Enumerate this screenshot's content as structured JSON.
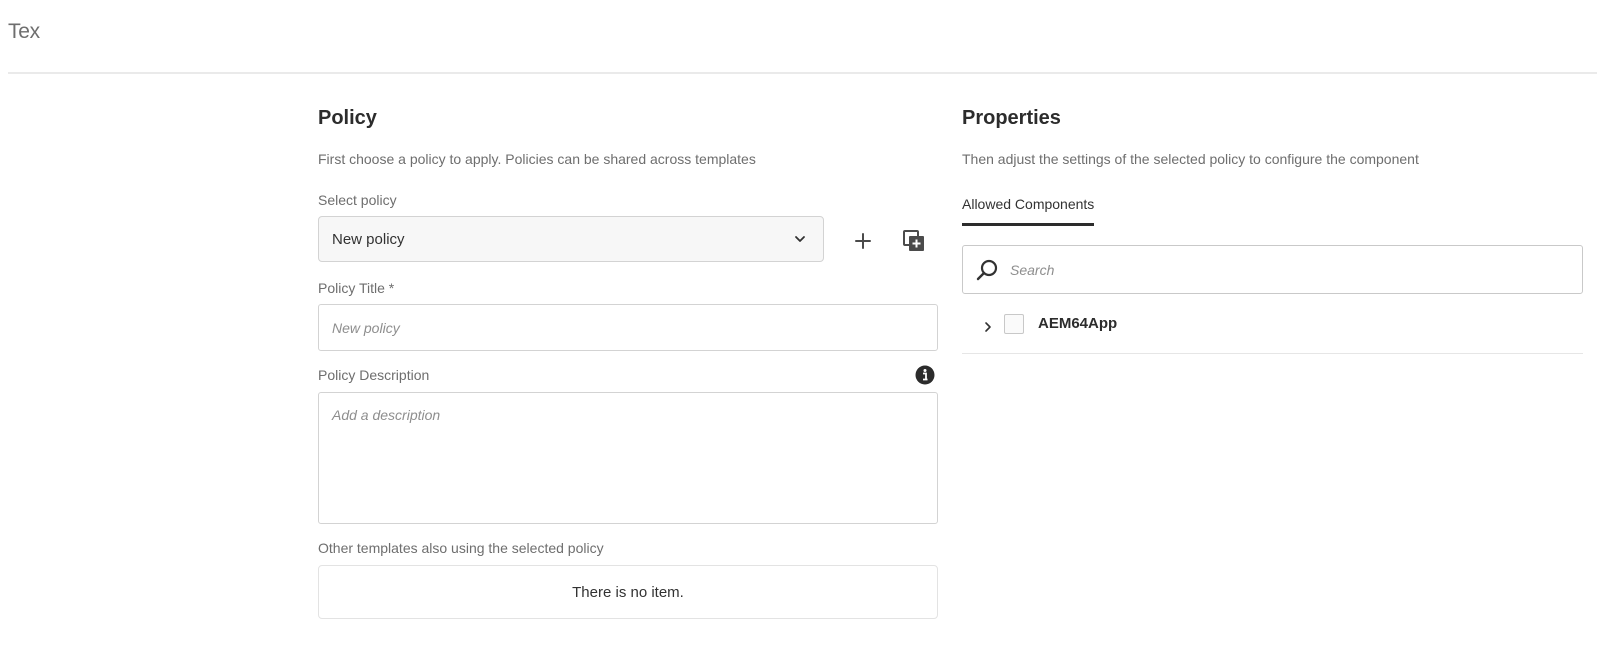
{
  "header": {
    "title": "Tex"
  },
  "policy": {
    "heading": "Policy",
    "description": "First choose a policy to apply. Policies can be shared across templates",
    "select_label": "Select policy",
    "select_value": "New policy",
    "add_icon": "plus-icon",
    "duplicate_icon": "duplicate-icon",
    "title_label": "Policy Title *",
    "title_placeholder": "New policy",
    "description_label": "Policy Description",
    "description_placeholder": "Add a description",
    "info_icon": "info-icon",
    "other_templates_label": "Other templates also using the selected policy",
    "other_templates_empty": "There is no item."
  },
  "properties": {
    "heading": "Properties",
    "description": "Then adjust the settings of the selected policy to configure the component",
    "tabs": [
      {
        "label": "Allowed Components",
        "selected": true
      }
    ],
    "search_placeholder": "Search",
    "tree": [
      {
        "label": "AEM64App",
        "expanded": false,
        "checked": false
      }
    ]
  },
  "colors": {
    "text_primary": "#2c2c2c",
    "text_secondary": "#6e6e6e",
    "border": "#d3d3d3",
    "tab_indicator": "#2c2c2c"
  }
}
